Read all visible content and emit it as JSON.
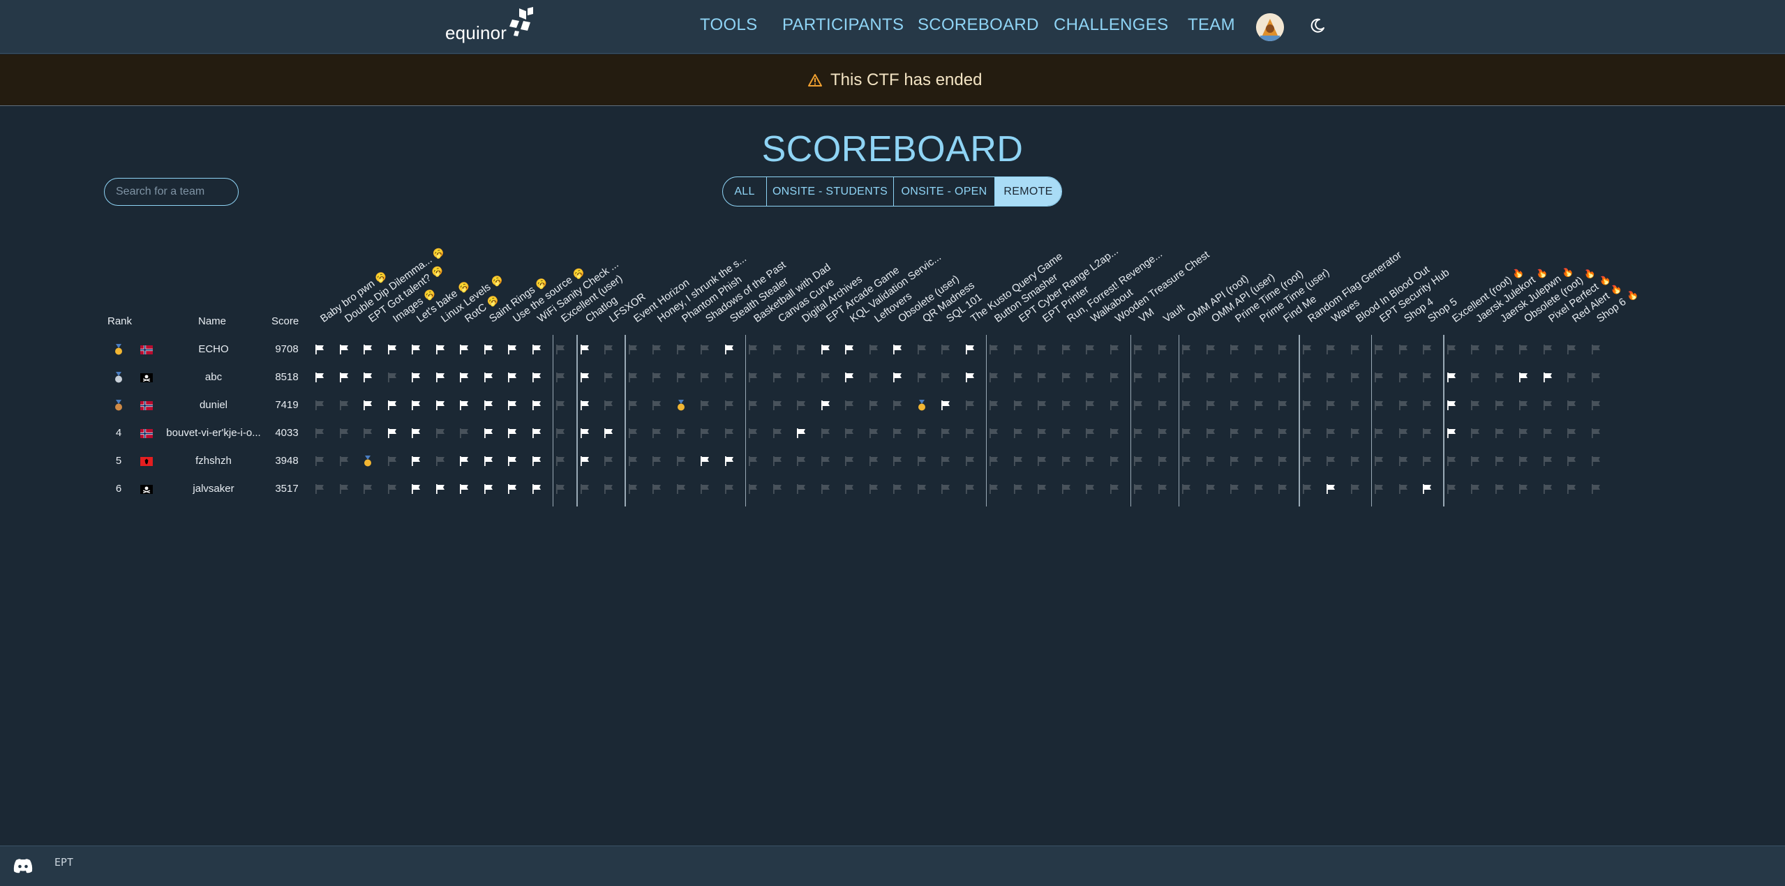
{
  "nav": {
    "logo_text": "equinor",
    "items": [
      "TOOLS",
      "PARTICIPANTS",
      "SCOREBOARD",
      "CHALLENGES",
      "TEAM"
    ],
    "avatar_icon": "user-avatar",
    "theme_icon": "moon-icon"
  },
  "banner": {
    "text": "This CTF has ended",
    "icon": "warning-icon"
  },
  "page": {
    "title": "SCOREBOARD"
  },
  "search": {
    "placeholder": "Search for a team"
  },
  "filters": {
    "items": [
      "ALL",
      "ONSITE - STUDENTS",
      "ONSITE - OPEN",
      "REMOTE"
    ],
    "active": "REMOTE"
  },
  "table": {
    "headers": {
      "rank": "Rank",
      "name": "Name",
      "score": "Score"
    },
    "challenges": [
      {
        "name": "Baby bro pwn",
        "emoji": "🥱"
      },
      {
        "name": "Double Dip Dilemma...",
        "emoji": "🥱"
      },
      {
        "name": "EPT Got talent?",
        "emoji": "🥱"
      },
      {
        "name": "Images",
        "emoji": "🥱"
      },
      {
        "name": "Let's bake",
        "emoji": "🥱"
      },
      {
        "name": "Linux Levels",
        "emoji": "🥱"
      },
      {
        "name": "RotC",
        "emoji": "🥱"
      },
      {
        "name": "Saint Rings",
        "emoji": "🥱"
      },
      {
        "name": "Use the source",
        "emoji": "🥱"
      },
      {
        "name": "WiFi Sanity Check ...",
        "emoji": ""
      },
      {
        "name": "Excellent (user)",
        "emoji": ""
      },
      {
        "name": "Chatlog",
        "emoji": ""
      },
      {
        "name": "LFSXOR",
        "emoji": ""
      },
      {
        "name": "Event Horizon",
        "emoji": ""
      },
      {
        "name": "Honey, I shrunk the s...",
        "emoji": ""
      },
      {
        "name": "Phantom Phish",
        "emoji": ""
      },
      {
        "name": "Shadows of the Past",
        "emoji": ""
      },
      {
        "name": "Stealth Stealer",
        "emoji": ""
      },
      {
        "name": "Basketball with Dad",
        "emoji": ""
      },
      {
        "name": "Canvas Curve",
        "emoji": ""
      },
      {
        "name": "Digital Archives",
        "emoji": ""
      },
      {
        "name": "EPT Arcade Game",
        "emoji": ""
      },
      {
        "name": "KQL Validation Servic...",
        "emoji": ""
      },
      {
        "name": "Leftovers",
        "emoji": ""
      },
      {
        "name": "Obsolete (user)",
        "emoji": ""
      },
      {
        "name": "QR Madness",
        "emoji": ""
      },
      {
        "name": "SQL 101",
        "emoji": ""
      },
      {
        "name": "The Kusto Query Game",
        "emoji": ""
      },
      {
        "name": "Button Smasher",
        "emoji": ""
      },
      {
        "name": "EPT Cyber Range L2ap...",
        "emoji": ""
      },
      {
        "name": "EPT Printer",
        "emoji": ""
      },
      {
        "name": "Run, Forrest! Revenge...",
        "emoji": ""
      },
      {
        "name": "Walkabout",
        "emoji": ""
      },
      {
        "name": "Wooden Treasure Chest",
        "emoji": ""
      },
      {
        "name": "VM",
        "emoji": ""
      },
      {
        "name": "Vault",
        "emoji": ""
      },
      {
        "name": "OMM API (root)",
        "emoji": ""
      },
      {
        "name": "OMM API (user)",
        "emoji": ""
      },
      {
        "name": "Prime Time (root)",
        "emoji": ""
      },
      {
        "name": "Prime Time (user)",
        "emoji": ""
      },
      {
        "name": "Find Me",
        "emoji": ""
      },
      {
        "name": "Random Flag Generator",
        "emoji": ""
      },
      {
        "name": "Waves",
        "emoji": ""
      },
      {
        "name": "Blood In Blood Out",
        "emoji": ""
      },
      {
        "name": "EPT Security Hub",
        "emoji": ""
      },
      {
        "name": "Shop 4",
        "emoji": ""
      },
      {
        "name": "Shop 5",
        "emoji": ""
      },
      {
        "name": "Excellent (root)",
        "emoji": "🔥"
      },
      {
        "name": "Jaersk Julekort",
        "emoji": "🔥"
      },
      {
        "name": "Jaersk Julepwn",
        "emoji": "🔥"
      },
      {
        "name": "Obsolete (root)",
        "emoji": "🔥"
      },
      {
        "name": "Pixel Perfect",
        "emoji": "🔥"
      },
      {
        "name": "Red Alert",
        "emoji": "🔥"
      },
      {
        "name": "Shop 6",
        "emoji": "🔥"
      }
    ],
    "separators_after": [
      9,
      10,
      12,
      17,
      27,
      33,
      35,
      40,
      43,
      46
    ],
    "rows": [
      {
        "rank": "",
        "rank_icon": "gold-medal-icon",
        "country": "norway-flag-icon",
        "name": "ECHO",
        "score": "9708",
        "solves": "111111111101000001000110100100000000000000000000000000"
      },
      {
        "rank": "",
        "rank_icon": "silver-medal-icon",
        "country": "pirate-flag-icon",
        "name": "abc",
        "score": "8518",
        "solves": "111011111101000000000010100100000000000000000001001100"
      },
      {
        "rank": "",
        "rank_icon": "bronze-medal-icon",
        "country": "norway-flag-icon",
        "name": "duniel",
        "score": "7419",
        "solves": "001111111101000200000100021000000000000000000001000000"
      },
      {
        "rank": "4",
        "rank_icon": "",
        "country": "norway-flag-icon",
        "name": "bouvet-vi-er'kje-i-o...",
        "score": "4033",
        "solves": "000110011101100000001000000000000000000000000001000000"
      },
      {
        "rank": "5",
        "rank_icon": "",
        "country": "albania-flag-icon",
        "name": "fzhshzh",
        "score": "3948",
        "solves": "002010111101000011000000000000000000000000000000000000"
      },
      {
        "rank": "6",
        "rank_icon": "",
        "country": "pirate-flag-icon",
        "name": "jalvsaker",
        "score": "3517",
        "solves": "000011111100000000000000000000000000000000100010000000"
      }
    ]
  },
  "footer": {
    "discord_icon": "discord-icon",
    "ept_label": "EPT"
  },
  "colors": {
    "background": "#1b2834",
    "navbar": "#263847",
    "accent": "#8fd4f5",
    "banner_bg": "#241c10",
    "solved_flag": "#ffffff",
    "unsolved_flag": "#48525b"
  }
}
